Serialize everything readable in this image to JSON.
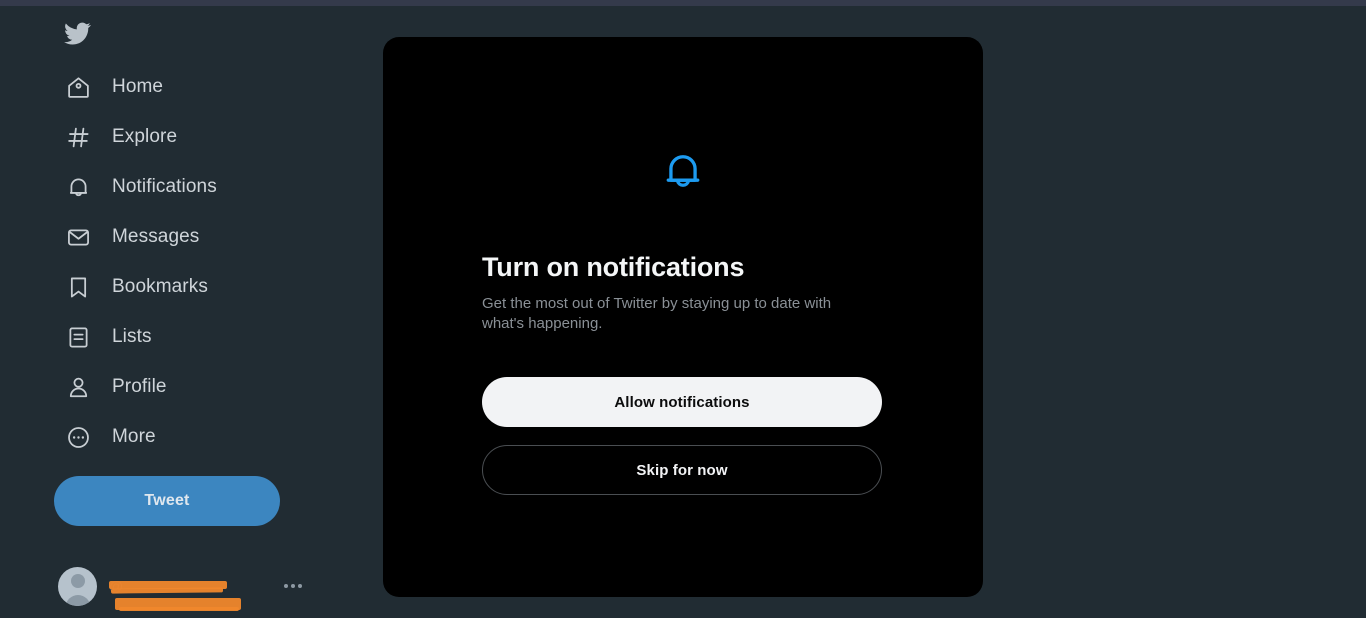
{
  "app": {
    "name": "Twitter",
    "logo_icon": "twitter-bird-icon"
  },
  "sidebar": {
    "items": [
      {
        "label": "Home",
        "icon": "home-icon"
      },
      {
        "label": "Explore",
        "icon": "hashtag-icon"
      },
      {
        "label": "Notifications",
        "icon": "bell-icon"
      },
      {
        "label": "Messages",
        "icon": "envelope-icon"
      },
      {
        "label": "Bookmarks",
        "icon": "bookmark-icon"
      },
      {
        "label": "Lists",
        "icon": "list-icon"
      },
      {
        "label": "Profile",
        "icon": "person-icon"
      },
      {
        "label": "More",
        "icon": "more-circle-icon"
      }
    ],
    "tweet_button": "Tweet",
    "account": {
      "display_name": "",
      "handle": "@",
      "redacted": true,
      "avatar_icon": "default-avatar-icon",
      "menu_icon": "more-horizontal-icon"
    }
  },
  "modal": {
    "icon": "bell-outline-icon",
    "title": "Turn on notifications",
    "description": "Get the most out of Twitter by staying up to date with what's happening.",
    "primary_button": "Allow notifications",
    "secondary_button": "Skip for now"
  },
  "colors": {
    "page_background": "#212c33",
    "top_strip": "#343a4b",
    "modal_background": "#000000",
    "accent_blue": "#1d9bf0",
    "tweet_button": "#3c86c0",
    "redaction_orange": "#f0872c",
    "text_primary": "#cfd5da",
    "text_secondary": "#8a9096"
  }
}
